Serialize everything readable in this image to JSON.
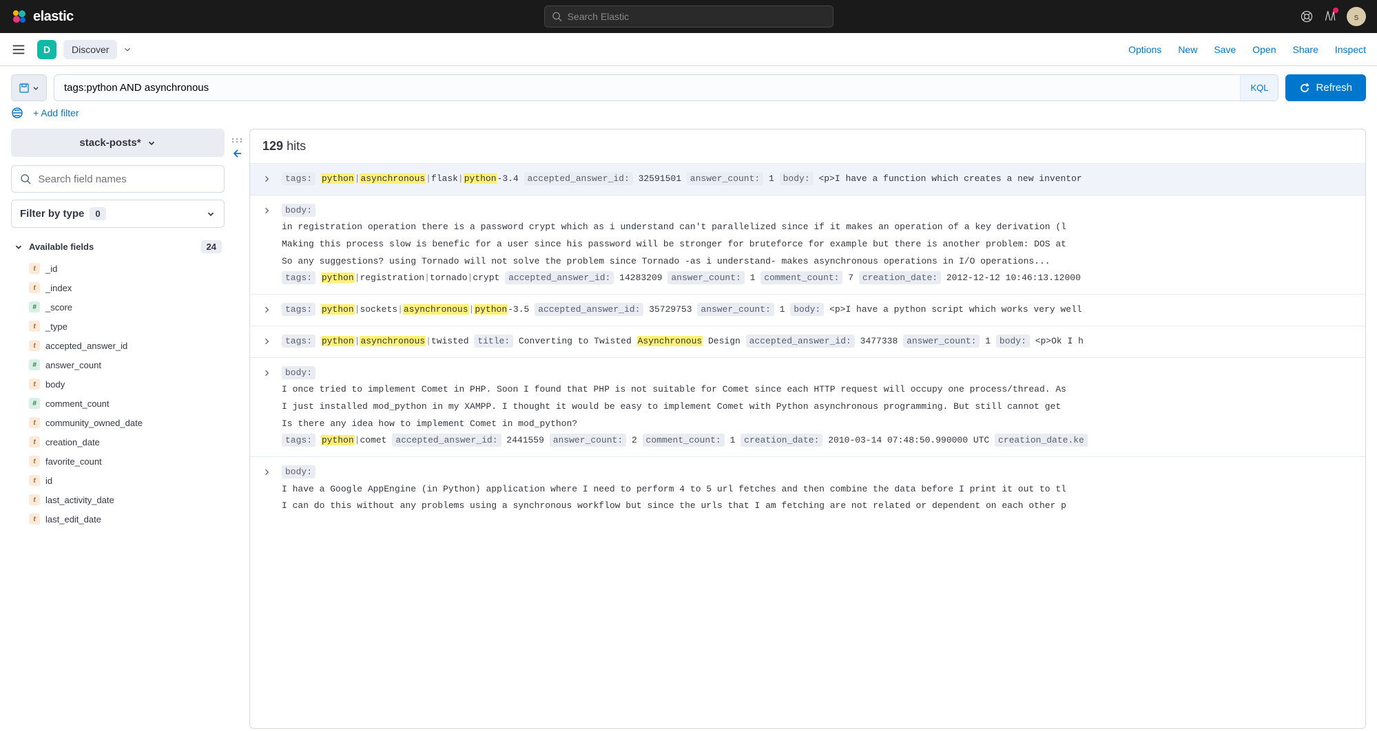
{
  "header": {
    "brand": "elastic",
    "search_placeholder": "Search Elastic",
    "avatar_initial": "s"
  },
  "nav": {
    "app_badge": "D",
    "app_name": "Discover",
    "links": [
      "Options",
      "New",
      "Save",
      "Open",
      "Share",
      "Inspect"
    ]
  },
  "query": {
    "value": "tags:python AND asynchronous",
    "lang_label": "KQL",
    "refresh_label": "Refresh",
    "add_filter_label": "+ Add filter"
  },
  "sidebar": {
    "index_name": "stack-posts*",
    "field_search_placeholder": "Search field names",
    "filter_by_type_label": "Filter by type",
    "filter_by_type_count": "0",
    "available_fields_label": "Available fields",
    "available_fields_count": "24",
    "fields": [
      {
        "type": "t",
        "name": "_id"
      },
      {
        "type": "t",
        "name": "_index"
      },
      {
        "type": "n",
        "name": "_score"
      },
      {
        "type": "t",
        "name": "_type"
      },
      {
        "type": "t",
        "name": "accepted_answer_id"
      },
      {
        "type": "n",
        "name": "answer_count"
      },
      {
        "type": "t",
        "name": "body"
      },
      {
        "type": "n",
        "name": "comment_count"
      },
      {
        "type": "t",
        "name": "community_owned_date"
      },
      {
        "type": "t",
        "name": "creation_date"
      },
      {
        "type": "t",
        "name": "favorite_count"
      },
      {
        "type": "t",
        "name": "id"
      },
      {
        "type": "t",
        "name": "last_activity_date"
      },
      {
        "type": "t",
        "name": "last_edit_date"
      }
    ]
  },
  "results": {
    "hits_count": "129",
    "hits_label": "hits",
    "docs": [
      {
        "selected": true,
        "multiline": false,
        "lines": [
          [
            {
              "t": "fld",
              "v": "tags:"
            },
            {
              "t": "txt",
              "v": " "
            },
            {
              "t": "hl",
              "v": "python"
            },
            {
              "t": "sep",
              "v": "|"
            },
            {
              "t": "hl",
              "v": "asynchronous"
            },
            {
              "t": "sep",
              "v": "|"
            },
            {
              "t": "txt",
              "v": "flask"
            },
            {
              "t": "sep",
              "v": "|"
            },
            {
              "t": "hl",
              "v": "python"
            },
            {
              "t": "txt",
              "v": "-3.4  "
            },
            {
              "t": "fld",
              "v": "accepted_answer_id:"
            },
            {
              "t": "txt",
              "v": " 32591501  "
            },
            {
              "t": "fld",
              "v": "answer_count:"
            },
            {
              "t": "txt",
              "v": " 1  "
            },
            {
              "t": "fld",
              "v": "body:"
            },
            {
              "t": "txt",
              "v": " <p>I have a function which creates a new inventor"
            }
          ]
        ]
      },
      {
        "selected": false,
        "multiline": true,
        "lines": [
          [
            {
              "t": "fld",
              "v": "body:"
            }
          ],
          [
            {
              "t": "body",
              "v": "in registration operation there is a password crypt which as i understand can't parallelized since if it makes an operation of a key derivation (l"
            }
          ],
          [
            {
              "t": "body",
              "v": "Making this process slow is benefic for a user since his password will be stronger for bruteforce for example but there is another problem: DOS at"
            }
          ],
          [
            {
              "t": "body",
              "v": "So any suggestions? using Tornado will not solve the problem since Tornado -as i understand- makes asynchronous operations in I/O operations..."
            }
          ],
          [
            {
              "t": "fld",
              "v": "tags:"
            },
            {
              "t": "txt",
              "v": " "
            },
            {
              "t": "hl",
              "v": "python"
            },
            {
              "t": "sep",
              "v": "|"
            },
            {
              "t": "txt",
              "v": "registration"
            },
            {
              "t": "sep",
              "v": "|"
            },
            {
              "t": "txt",
              "v": "tornado"
            },
            {
              "t": "sep",
              "v": "|"
            },
            {
              "t": "txt",
              "v": "crypt  "
            },
            {
              "t": "fld",
              "v": "accepted_answer_id:"
            },
            {
              "t": "txt",
              "v": " 14283209  "
            },
            {
              "t": "fld",
              "v": "answer_count:"
            },
            {
              "t": "txt",
              "v": " 1  "
            },
            {
              "t": "fld",
              "v": "comment_count:"
            },
            {
              "t": "txt",
              "v": " 7  "
            },
            {
              "t": "fld",
              "v": "creation_date:"
            },
            {
              "t": "txt",
              "v": " 2012-12-12 10:46:13.12000"
            }
          ]
        ]
      },
      {
        "selected": false,
        "multiline": false,
        "lines": [
          [
            {
              "t": "fld",
              "v": "tags:"
            },
            {
              "t": "txt",
              "v": " "
            },
            {
              "t": "hl",
              "v": "python"
            },
            {
              "t": "sep",
              "v": "|"
            },
            {
              "t": "txt",
              "v": "sockets"
            },
            {
              "t": "sep",
              "v": "|"
            },
            {
              "t": "hl",
              "v": "asynchronous"
            },
            {
              "t": "sep",
              "v": "|"
            },
            {
              "t": "hl",
              "v": "python"
            },
            {
              "t": "txt",
              "v": "-3.5  "
            },
            {
              "t": "fld",
              "v": "accepted_answer_id:"
            },
            {
              "t": "txt",
              "v": " 35729753  "
            },
            {
              "t": "fld",
              "v": "answer_count:"
            },
            {
              "t": "txt",
              "v": " 1  "
            },
            {
              "t": "fld",
              "v": "body:"
            },
            {
              "t": "txt",
              "v": " <p>I have a python script which works very well"
            }
          ]
        ]
      },
      {
        "selected": false,
        "multiline": false,
        "lines": [
          [
            {
              "t": "fld",
              "v": "tags:"
            },
            {
              "t": "txt",
              "v": " "
            },
            {
              "t": "hl",
              "v": "python"
            },
            {
              "t": "sep",
              "v": "|"
            },
            {
              "t": "hl",
              "v": "asynchronous"
            },
            {
              "t": "sep",
              "v": "|"
            },
            {
              "t": "txt",
              "v": "twisted  "
            },
            {
              "t": "fld",
              "v": "title:"
            },
            {
              "t": "txt",
              "v": " Converting to Twisted "
            },
            {
              "t": "hl",
              "v": "Asynchronous"
            },
            {
              "t": "txt",
              "v": " Design  "
            },
            {
              "t": "fld",
              "v": "accepted_answer_id:"
            },
            {
              "t": "txt",
              "v": " 3477338  "
            },
            {
              "t": "fld",
              "v": "answer_count:"
            },
            {
              "t": "txt",
              "v": " 1  "
            },
            {
              "t": "fld",
              "v": "body:"
            },
            {
              "t": "txt",
              "v": " <p>Ok I h"
            }
          ]
        ]
      },
      {
        "selected": false,
        "multiline": true,
        "lines": [
          [
            {
              "t": "fld",
              "v": "body:"
            }
          ],
          [
            {
              "t": "body",
              "v": "I once tried to implement Comet in PHP. Soon I found that PHP is not suitable for Comet since each HTTP request will occupy one process/thread. As"
            }
          ],
          [
            {
              "t": "body",
              "v": "I just installed mod_python in my XAMPP. I thought it would be easy to implement Comet with Python asynchronous programming. But still cannot get"
            }
          ],
          [
            {
              "t": "body",
              "v": "Is there any idea how to implement Comet in mod_python?"
            }
          ],
          [
            {
              "t": "fld",
              "v": "tags:"
            },
            {
              "t": "txt",
              "v": " "
            },
            {
              "t": "hl",
              "v": "python"
            },
            {
              "t": "sep",
              "v": "|"
            },
            {
              "t": "txt",
              "v": "comet  "
            },
            {
              "t": "fld",
              "v": "accepted_answer_id:"
            },
            {
              "t": "txt",
              "v": " 2441559  "
            },
            {
              "t": "fld",
              "v": "answer_count:"
            },
            {
              "t": "txt",
              "v": " 2  "
            },
            {
              "t": "fld",
              "v": "comment_count:"
            },
            {
              "t": "txt",
              "v": " 1  "
            },
            {
              "t": "fld",
              "v": "creation_date:"
            },
            {
              "t": "txt",
              "v": " 2010-03-14 07:48:50.990000 UTC  "
            },
            {
              "t": "fld",
              "v": "creation_date.ke"
            }
          ]
        ]
      },
      {
        "selected": false,
        "multiline": true,
        "lines": [
          [
            {
              "t": "fld",
              "v": "body:"
            }
          ],
          [
            {
              "t": "body",
              "v": "I have a Google AppEngine (in Python) application where I need to perform 4 to 5 url fetches and then combine the data before I print it out to tl"
            }
          ],
          [
            {
              "t": "body",
              "v": "I can do this without any problems using a synchronous workflow but since the urls that I am fetching are not related or dependent on each other p"
            }
          ]
        ]
      }
    ]
  }
}
